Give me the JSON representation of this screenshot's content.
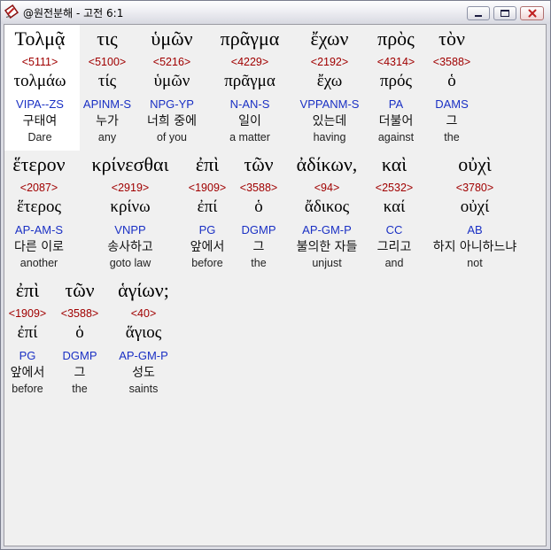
{
  "window": {
    "title": "@원전분해 - 고전 6:1",
    "app_icon": "app-icon",
    "buttons": {
      "minimize": "minimize-icon",
      "maximize": "maximize-icon",
      "close": "close-icon"
    }
  },
  "colors": {
    "strongs_number": "#a00000",
    "morphology": "#1a30c4",
    "selected_background": "#ffffff",
    "pane_background": "#f0f0f0"
  },
  "lines": [
    {
      "words": [
        {
          "greek": "Τολμᾷ",
          "strongs": "<5111>",
          "lemma": "τολμάω",
          "morph": "VIPA--ZS",
          "korean": "구태여",
          "english": "Dare",
          "selected": true
        },
        {
          "greek": "τις",
          "strongs": "<5100>",
          "lemma": "τίς",
          "morph": "APINM-S",
          "korean": "누가",
          "english": "any"
        },
        {
          "greek": "ὑμῶν",
          "strongs": "<5216>",
          "lemma": "ὑμῶν",
          "morph": "NPG-YP",
          "korean": "너희 중에",
          "english": "of you"
        },
        {
          "greek": "πρᾶγμα",
          "strongs": "<4229>",
          "lemma": "πρᾶγμα",
          "morph": "N-AN-S",
          "korean": "일이",
          "english": "a matter"
        },
        {
          "greek": "ἔχων",
          "strongs": "<2192>",
          "lemma": "ἔχω",
          "morph": "VPPANM-S",
          "korean": "있는데",
          "english": "having"
        },
        {
          "greek": "πρὸς",
          "strongs": "<4314>",
          "lemma": "πρός",
          "morph": "PA",
          "korean": "더불어",
          "english": "against"
        },
        {
          "greek": "τὸν",
          "strongs": "<3588>",
          "lemma": "ὁ",
          "morph": "DAMS",
          "korean": "그",
          "english": "the"
        }
      ]
    },
    {
      "words": [
        {
          "greek": "ἕτερον",
          "strongs": "<2087>",
          "lemma": "ἕτερος",
          "morph": "AP-AM-S",
          "korean": "다른 이로",
          "english": "another"
        },
        {
          "greek": "κρίνεσθαι",
          "strongs": "<2919>",
          "lemma": "κρίνω",
          "morph": "VNPP",
          "korean": "송사하고",
          "english": "goto law"
        },
        {
          "greek": "ἐπὶ",
          "strongs": "<1909>",
          "lemma": "ἐπί",
          "morph": "PG",
          "korean": "앞에서",
          "english": "before"
        },
        {
          "greek": "τῶν",
          "strongs": "<3588>",
          "lemma": "ὁ",
          "morph": "DGMP",
          "korean": "그",
          "english": "the"
        },
        {
          "greek": "ἀδίκων,",
          "strongs": "<94>",
          "lemma": "ἄδικος",
          "morph": "AP-GM-P",
          "korean": "불의한 자들",
          "english": "unjust"
        },
        {
          "greek": "καὶ",
          "strongs": "<2532>",
          "lemma": "καί",
          "morph": "CC",
          "korean": "그리고",
          "english": "and"
        },
        {
          "greek": "οὐχὶ",
          "strongs": "<3780>",
          "lemma": "οὐχί",
          "morph": "AB",
          "korean": "하지 아니하느냐",
          "english": "not"
        }
      ]
    },
    {
      "words": [
        {
          "greek": "ἐπὶ",
          "strongs": "<1909>",
          "lemma": "ἐπί",
          "morph": "PG",
          "korean": "앞에서",
          "english": "before"
        },
        {
          "greek": "τῶν",
          "strongs": "<3588>",
          "lemma": "ὁ",
          "morph": "DGMP",
          "korean": "그",
          "english": "the"
        },
        {
          "greek": "ἁγίων;",
          "strongs": "<40>",
          "lemma": "ἅγιος",
          "morph": "AP-GM-P",
          "korean": "성도",
          "english": "saints"
        }
      ]
    }
  ]
}
